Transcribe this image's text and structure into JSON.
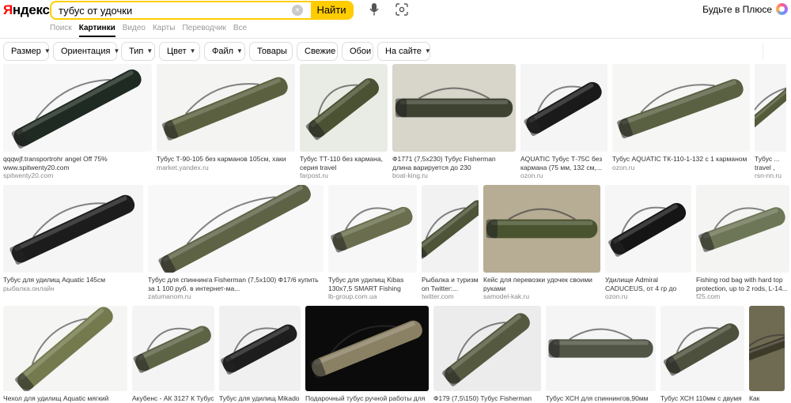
{
  "logo": {
    "first": "Я",
    "rest": "ндекс"
  },
  "search": {
    "query": "тубус от удочки",
    "button": "Найти"
  },
  "header": {
    "plus_label": "Будьте в Плюсе"
  },
  "services": [
    "Поиск",
    "Картинки",
    "Видео",
    "Карты",
    "Переводчик",
    "Все"
  ],
  "filters": [
    {
      "label": "Размер",
      "dropdown": true
    },
    {
      "label": "Ориентация",
      "dropdown": true
    },
    {
      "label": "Тип",
      "dropdown": true
    },
    {
      "label": "Цвет",
      "dropdown": true
    },
    {
      "label": "Файл",
      "dropdown": true
    },
    {
      "label": "Товары",
      "dropdown": false
    },
    {
      "label": "Свежие",
      "dropdown": false
    },
    {
      "label": "Обои",
      "dropdown": false
    },
    {
      "label": "На сайте",
      "dropdown": true
    }
  ],
  "results": [
    [
      {
        "caption": "qqqwjf.transportrohr angel Off 75% www.spitwenty20.com",
        "source": "spitwenty20.com",
        "bg": "#f7f7f7",
        "color": "#1f2a22"
      },
      {
        "caption": "Тубус Т-90-105 без карманов 105см, хаки",
        "source": "market.yandex.ru",
        "bg": "#f4f4f2",
        "color": "#5b6140"
      },
      {
        "caption": "Тубус ТТ-110 без кармана, серия travel",
        "source": "farpost.ru",
        "bg": "#e9ece4",
        "color": "#4a5233"
      },
      {
        "caption": "Ф1771 (7,5х230) Тубус Fisherman длина варируется до 230",
        "source": "boat-king.ru",
        "bg": "#d8d5ca",
        "color": "#3d4231"
      },
      {
        "caption": "AQUATIC Тубус Т-75С без кармана (75 мм, 132 см,...",
        "source": "ozon.ru",
        "bg": "#f5f5f5",
        "color": "#1a1a1a"
      },
      {
        "caption": "Тубус AQUATIC ТК-110-1-132 с 1 карманом",
        "source": "ozon.ru",
        "bg": "#f6f6f4",
        "color": "#5a6143"
      },
      {
        "caption": "Тубус ... travel , цве...",
        "source": "rsn-nn.ru",
        "bg": "#f5f5f5",
        "color": "#545b3a"
      }
    ],
    [
      {
        "caption": "Тубус для удилищ Aquatic 145см",
        "source": "рыбалка.онлайн",
        "bg": "#f5f5f5",
        "color": "#1c1c1c"
      },
      {
        "caption": "Тубус для спиннинга Fisherman (7,5х100) Ф17/6 купить за 1 100 руб. в интернет-ма...",
        "source": "zatumanom.ru",
        "bg": "#f8f8f8",
        "color": "#5f6346"
      },
      {
        "caption": "Тубус для удилищ Kibas 130х7,5 SMART Fishing (332)",
        "source": "lb-group.com.ua",
        "bg": "#f7f7f7",
        "color": "#6a6e4e"
      },
      {
        "caption": "Рыбалка и туризм on Twitter:...",
        "source": "twitter.com",
        "bg": "#f2f2f2",
        "color": "#4d5438"
      },
      {
        "caption": "Кейс для перевозки удочек своими руками",
        "source": "samodel-kak.ru",
        "bg": "#b7ad95",
        "color": "#4a5330"
      },
      {
        "caption": "Удилище Admiral CADUCEUS, от 4 гр до 18гр,...",
        "source": "ozon.ru",
        "bg": "#f6f6f6",
        "color": "#151515"
      },
      {
        "caption": "Fishing rod bag with hard top protection, up to 2 rods, L-14...",
        "source": "f25.com",
        "bg": "#f4f4f2",
        "color": "#6d7656"
      }
    ],
    [
      {
        "caption": "Чехол для удилищ Aquatic мягкий 145см",
        "source": "",
        "bg": "#f5f5f3",
        "color": "#747a4e"
      },
      {
        "caption": "Акубенс - АК 3127 К Тубус",
        "source": "",
        "bg": "#f4f4f4",
        "color": "#5d6446"
      },
      {
        "caption": "Тубус для удилищ Mikado",
        "source": "",
        "bg": "#f0f0f0",
        "color": "#1d1d1d"
      },
      {
        "caption": "Подарочный тубус ручной работы для",
        "source": "",
        "bg": "#0b0b0b",
        "color": "#8a8064"
      },
      {
        "caption": "Ф179 (7,5\\150) Тубус Fisherman",
        "source": "",
        "bg": "#ececec",
        "color": "#54593f"
      },
      {
        "caption": "Тубус ХСН для спиннингов,90мм",
        "source": "",
        "bg": "#f5f5f5",
        "color": "#505545"
      },
      {
        "caption": "Тубус ХСН 110мм с двумя",
        "source": "",
        "bg": "#f5f5f5",
        "color": "#4d503c"
      },
      {
        "caption": "Как храни...",
        "source": "",
        "bg": "#6f6a52",
        "color": "#3e3a2a"
      }
    ]
  ]
}
